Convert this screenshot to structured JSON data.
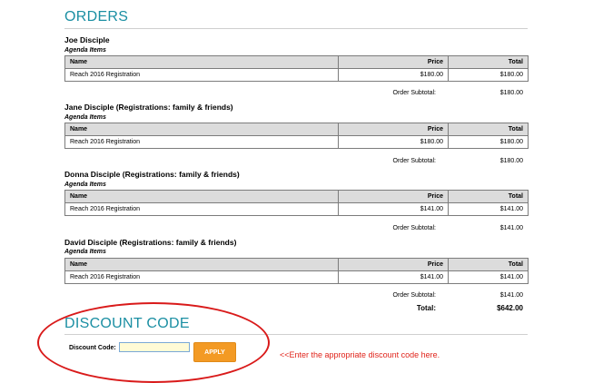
{
  "accent_color": "#1b8fa3",
  "annotation_color": "#e0241b",
  "orders_title": "ORDERS",
  "columns": {
    "name": "Name",
    "price": "Price",
    "total": "Total"
  },
  "agenda_label": "Agenda Items",
  "subtotal_label": "Order Subtotal:",
  "orders": [
    {
      "person": "Joe Disciple",
      "item": "Reach 2016 Registration",
      "price": "$180.00",
      "total": "$180.00",
      "subtotal": "$180.00"
    },
    {
      "person": "Jane Disciple (Registrations: family & friends)",
      "item": "Reach 2016 Registration",
      "price": "$180.00",
      "total": "$180.00",
      "subtotal": "$180.00"
    },
    {
      "person": "Donna Disciple (Registrations: family & friends)",
      "item": "Reach 2016 Registration",
      "price": "$141.00",
      "total": "$141.00",
      "subtotal": "$141.00"
    },
    {
      "person": "David Disciple (Registrations: family & friends)",
      "item": "Reach 2016 Registration",
      "price": "$141.00",
      "total": "$141.00",
      "subtotal": "$141.00"
    }
  ],
  "grand_total": {
    "label": "Total:",
    "value": "$642.00"
  },
  "discount": {
    "title": "DISCOUNT CODE",
    "label": "Discount Code:",
    "value": "",
    "apply_label": "APPLY",
    "hint": "<<Enter the appropriate discount code here."
  }
}
